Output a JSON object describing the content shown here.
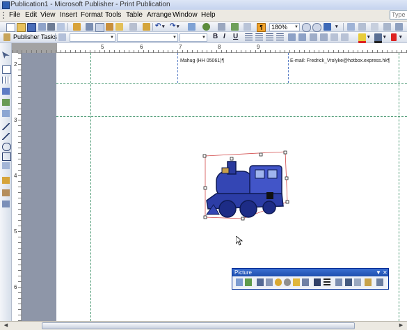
{
  "window": {
    "title": "Publication1 - Microsoft Publisher - Print Publication"
  },
  "menu": {
    "items": [
      "File",
      "Edit",
      "View",
      "Insert",
      "Format",
      "Tools",
      "Table",
      "Arrange",
      "Window",
      "Help"
    ],
    "help_box_placeholder": "Type a"
  },
  "toolbar": {
    "zoom": "180%",
    "publisher_tasks": "Publisher Tasks",
    "font_name": "",
    "font_size": ""
  },
  "ruler": {
    "h_numbers": [
      "5",
      "6",
      "7",
      "8",
      "9"
    ],
    "v_numbers": [
      "2",
      "3",
      "4",
      "5",
      "6"
    ]
  },
  "page": {
    "header_left": "Mahug (HH 05061)¶",
    "header_right": "E-mail: Fredrick_Vrolyke@hotbox.express.hk¶"
  },
  "picture_toolbar": {
    "title": "Picture"
  },
  "colors": {
    "accent": "#1e4fae",
    "guide": "#4c9a74",
    "workspace": "#8e96a8",
    "train": "#2d3fa8"
  },
  "icons": [
    "new-icon",
    "open-icon",
    "save-icon",
    "print-icon",
    "cut-icon",
    "copy-icon",
    "paste-icon",
    "undo-icon",
    "redo-icon",
    "zoom-in-icon",
    "zoom-out-icon",
    "bold-icon",
    "italic-icon",
    "underline-icon",
    "align-left-icon",
    "train-clipart"
  ]
}
